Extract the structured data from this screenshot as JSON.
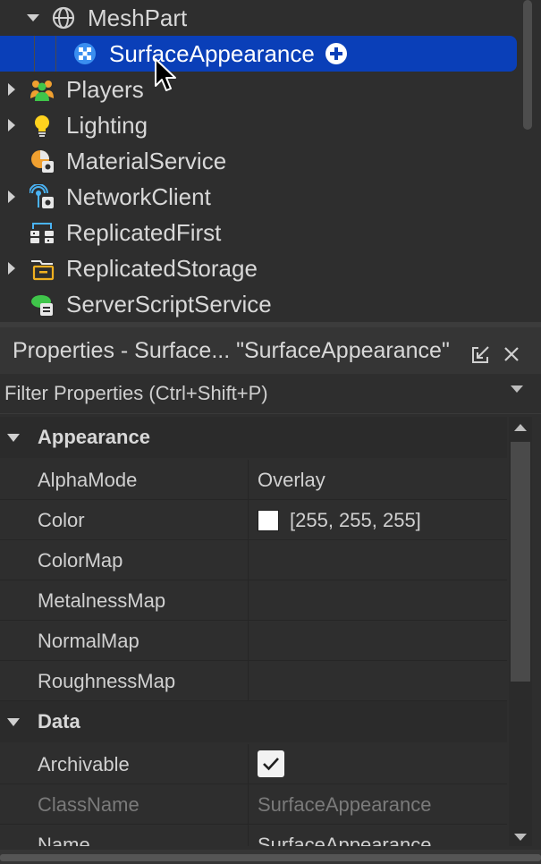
{
  "explorer": {
    "items": [
      {
        "label": "MeshPart",
        "icon": "meshpart-globe-icon",
        "expanded": true
      },
      {
        "label": "SurfaceAppearance",
        "icon": "surface-appearance-icon",
        "selected": true
      },
      {
        "label": "Players",
        "icon": "players-icon"
      },
      {
        "label": "Lighting",
        "icon": "lighting-bulb-icon"
      },
      {
        "label": "MaterialService",
        "icon": "material-service-icon"
      },
      {
        "label": "NetworkClient",
        "icon": "network-client-icon"
      },
      {
        "label": "ReplicatedFirst",
        "icon": "replicated-first-icon"
      },
      {
        "label": "ReplicatedStorage",
        "icon": "replicated-storage-icon"
      },
      {
        "label": "ServerScriptService",
        "icon": "server-script-service-icon"
      }
    ]
  },
  "properties": {
    "title": "Properties - Surface... \"SurfaceAppearance\"",
    "filter_placeholder": "Filter Properties (Ctrl+Shift+P)",
    "categories": [
      {
        "name": "Appearance",
        "rows": [
          {
            "name": "AlphaMode",
            "value": "Overlay"
          },
          {
            "name": "Color",
            "value": "[255, 255, 255]",
            "swatch": "#ffffff"
          },
          {
            "name": "ColorMap",
            "value": ""
          },
          {
            "name": "MetalnessMap",
            "value": ""
          },
          {
            "name": "NormalMap",
            "value": ""
          },
          {
            "name": "RoughnessMap",
            "value": ""
          }
        ]
      },
      {
        "name": "Data",
        "rows": [
          {
            "name": "Archivable",
            "checked": true
          },
          {
            "name": "ClassName",
            "value": "SurfaceAppearance"
          },
          {
            "name": "Name",
            "value": "SurfaceAppearance"
          }
        ]
      }
    ]
  },
  "colors": {
    "background": "#2e2e2e",
    "selection": "#0a3fb8",
    "text": "#d8d8d8",
    "disabled_text": "#7a7a7a"
  }
}
